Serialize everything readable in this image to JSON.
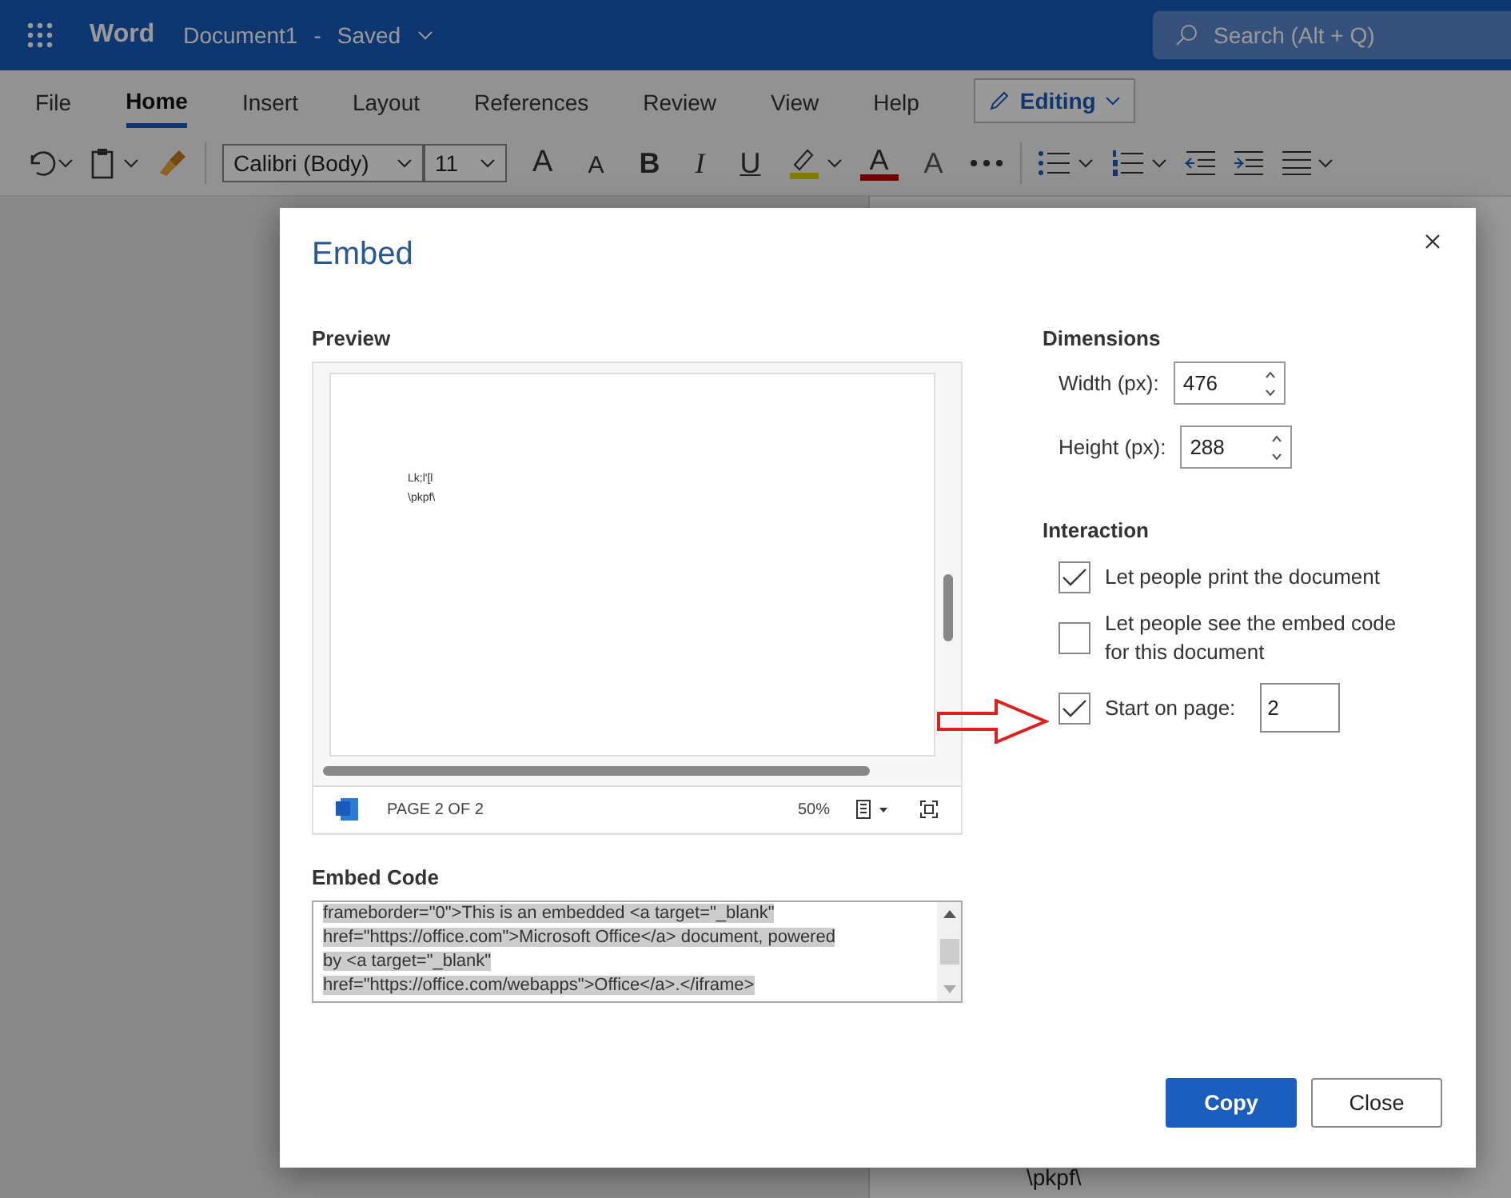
{
  "app": {
    "name": "Word",
    "document": "Document1",
    "separator": "-",
    "status": "Saved",
    "search_placeholder": "Search (Alt + Q)"
  },
  "ribbon_tabs": [
    {
      "label": "File",
      "selected": false
    },
    {
      "label": "Home",
      "selected": true
    },
    {
      "label": "Insert",
      "selected": false
    },
    {
      "label": "Layout",
      "selected": false
    },
    {
      "label": "References",
      "selected": false
    },
    {
      "label": "Review",
      "selected": false
    },
    {
      "label": "View",
      "selected": false
    },
    {
      "label": "Help",
      "selected": false
    }
  ],
  "mode": "Editing",
  "toolbar": {
    "font": "Calibri (Body)",
    "size": "11",
    "buttons": [
      {
        "kind": "grow",
        "label": "A"
      },
      {
        "kind": "shrink",
        "label": "A"
      },
      {
        "kind": "bold",
        "label": "B"
      },
      {
        "kind": "italic",
        "label": "I"
      },
      {
        "kind": "underline",
        "label": "U"
      },
      {
        "kind": "highlight"
      },
      {
        "kind": "fontcolor",
        "label": "A"
      },
      {
        "kind": "clear",
        "label": "A"
      },
      {
        "kind": "more"
      }
    ]
  },
  "document_text": "\\pkpf\\",
  "dialog": {
    "title": "Embed",
    "preview": {
      "label": "Preview",
      "lines": [
        "Lk;l'[l",
        "\\pkpf\\"
      ],
      "page_info": "PAGE 2 OF 2",
      "zoom": "50%"
    },
    "embed_code": {
      "label": "Embed Code",
      "lines": [
        "frameborder=\"0\">This is an embedded <a target=\"_blank\"",
        "href=\"https://office.com\">Microsoft Office</a> document, powered",
        "by <a target=\"_blank\"",
        "href=\"https://office.com/webapps\">Office</a>.</iframe>"
      ]
    },
    "dimensions": {
      "label": "Dimensions",
      "fields": [
        {
          "label": "Width (px):",
          "value": "476"
        },
        {
          "label": "Height (px):",
          "value": "288"
        }
      ]
    },
    "interaction": {
      "label": "Interaction",
      "options": [
        {
          "kind": "checkbox",
          "label": "Let people print the document",
          "checked": true
        },
        {
          "kind": "checkbox",
          "label": "Let people see the embed code for this document",
          "checked": false
        },
        {
          "kind": "page",
          "label": "Start on page:",
          "checked": true,
          "value": "2"
        }
      ]
    },
    "buttons": [
      {
        "label": "Copy",
        "kind": "primary"
      },
      {
        "label": "Close",
        "kind": "secondary"
      }
    ]
  }
}
